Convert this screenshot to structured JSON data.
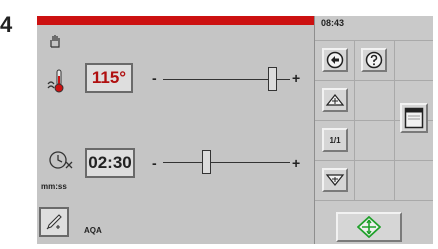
{
  "figure_number": "4",
  "clock": "08:43",
  "temperature": {
    "value": "115°",
    "minus": "-",
    "plus": "+",
    "level": 0.86,
    "value_color": "#b01010"
  },
  "timer": {
    "value": "02:30",
    "minus": "-",
    "plus": "+",
    "level": 0.34,
    "unit_label": "mm:ss"
  },
  "program_label": "AQA",
  "right_panel": {
    "page_label": "1/1"
  },
  "colors": {
    "status_bar": "#cc1111",
    "start_icon": "#1fa02a",
    "panel_bg": "#c5c5c5"
  },
  "icons": [
    "hand-icon",
    "thermometer-icon",
    "timer-icon",
    "pipette-icon",
    "back-arrow-icon",
    "help-icon",
    "scroll-up-icon",
    "scroll-down-icon",
    "window-icon",
    "start-icon"
  ]
}
